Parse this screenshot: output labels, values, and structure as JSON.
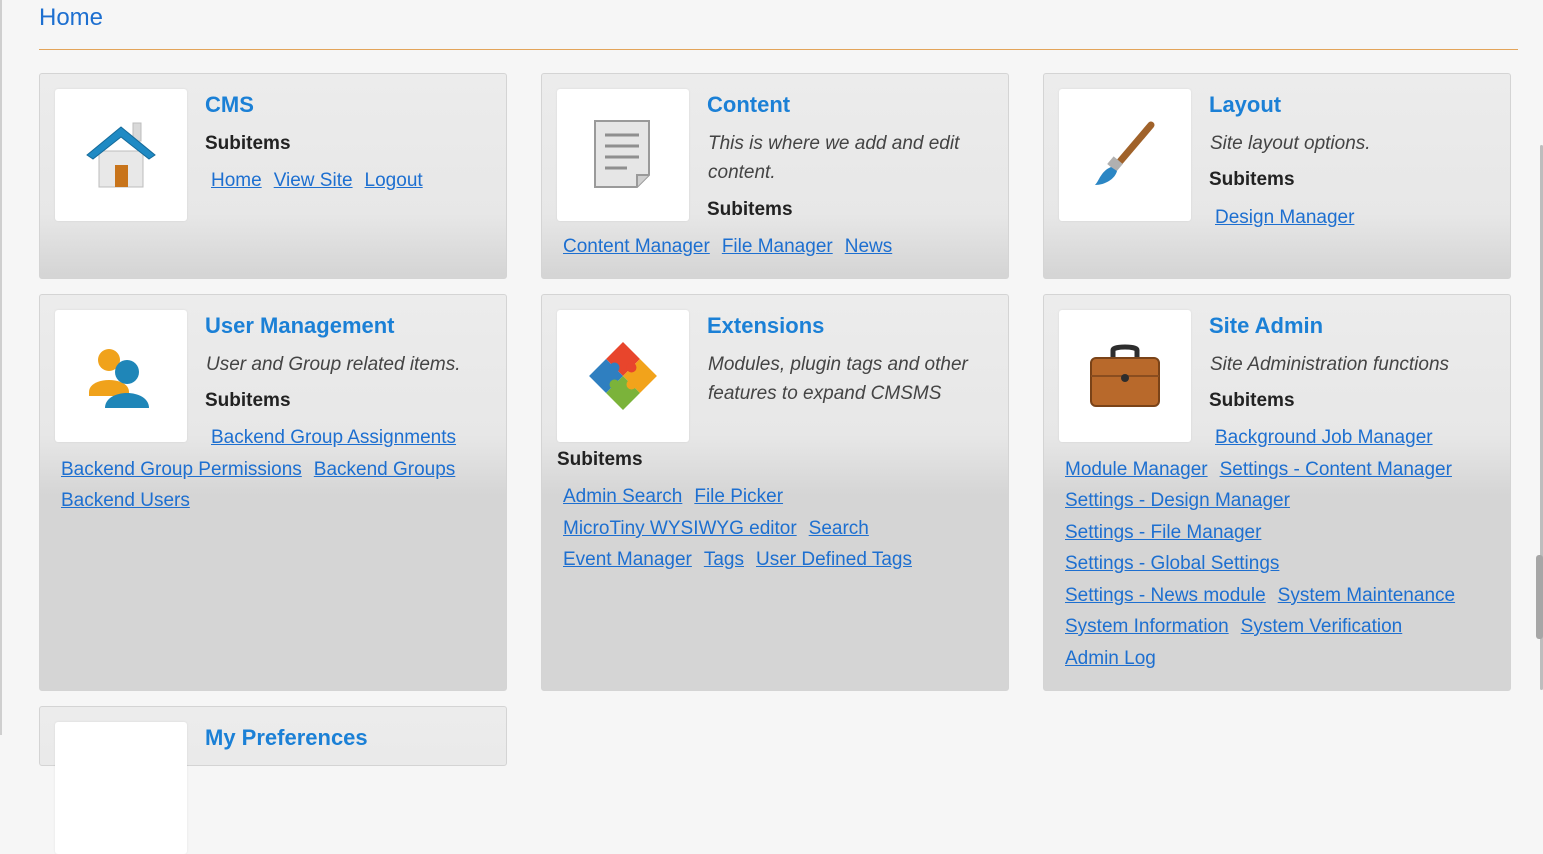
{
  "page": {
    "title": "Home"
  },
  "cards": {
    "cms": {
      "title": "CMS",
      "subitems_label": "Subitems",
      "links": [
        "Home",
        "View Site",
        "Logout"
      ]
    },
    "content": {
      "title": "Content",
      "description": "This is where we add and edit content.",
      "subitems_label": "Subitems",
      "links": [
        "Content Manager",
        "File Manager",
        "News"
      ]
    },
    "layout": {
      "title": "Layout",
      "description": "Site layout options.",
      "subitems_label": "Subitems",
      "links": [
        "Design Manager"
      ]
    },
    "user_management": {
      "title": "User Management",
      "description": "User and Group related items.",
      "subitems_label": "Subitems",
      "links": [
        "Backend Group Assignments",
        "Backend Group Permissions",
        "Backend Groups",
        "Backend Users"
      ]
    },
    "extensions": {
      "title": "Extensions",
      "description": "Modules, plugin tags and other features to expand CMSMS",
      "subitems_label": "Subitems",
      "links": [
        "Admin Search",
        "File Picker",
        "MicroTiny WYSIWYG editor",
        "Search",
        "Event Manager",
        "Tags",
        "User Defined Tags"
      ]
    },
    "site_admin": {
      "title": "Site Admin",
      "description": "Site Administration functions",
      "subitems_label": "Subitems",
      "links": [
        "Background Job Manager",
        "Module Manager",
        "Settings - Content Manager",
        "Settings - Design Manager",
        "Settings - File Manager",
        "Settings - Global Settings",
        "Settings - News module",
        "System Maintenance",
        "System Information",
        "System Verification",
        "Admin Log"
      ]
    },
    "my_preferences": {
      "title": "My Preferences"
    }
  },
  "icons": {
    "cms": "house-icon",
    "content": "document-icon",
    "layout": "paintbrush-icon",
    "user_management": "users-icon",
    "extensions": "puzzle-icon",
    "site_admin": "briefcase-icon"
  },
  "colors": {
    "accent": "#1b80d6",
    "link": "#1d6fd0",
    "rule": "#e3a45a"
  }
}
